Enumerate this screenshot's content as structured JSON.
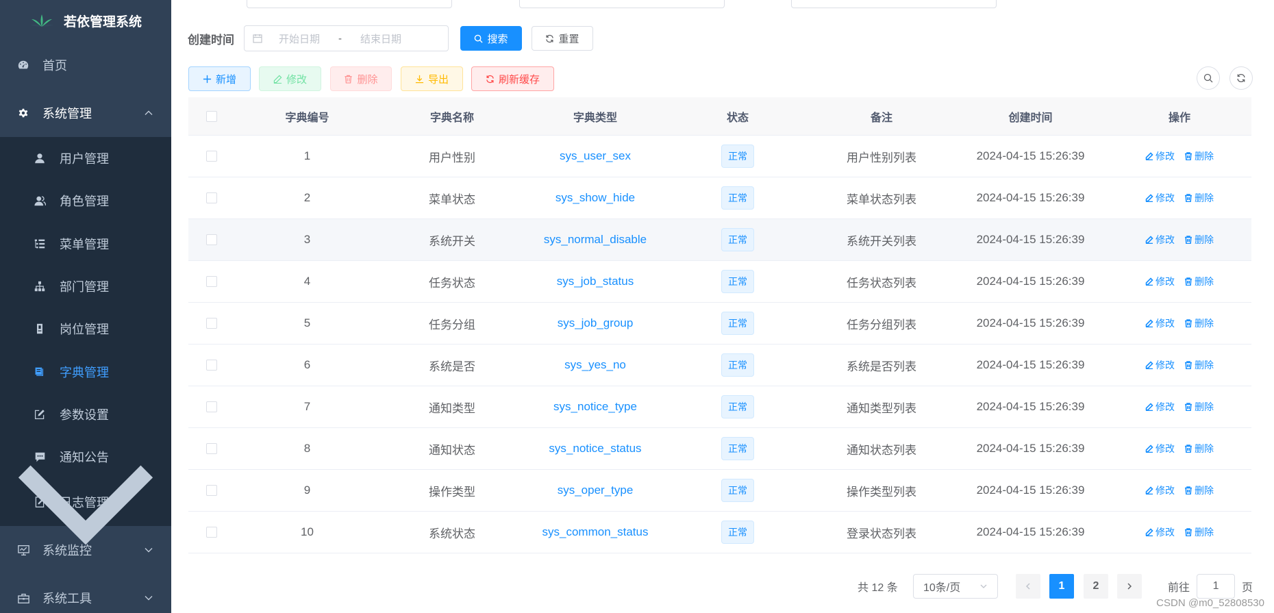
{
  "sidebar": {
    "logo_text": "若依管理系统",
    "items": [
      {
        "label": "首页",
        "icon": "dashboard-icon"
      },
      {
        "label": "系统管理",
        "icon": "gear-icon",
        "expanded": true
      },
      {
        "label": "系统监控",
        "icon": "monitor-icon"
      },
      {
        "label": "系统工具",
        "icon": "toolbox-icon"
      }
    ],
    "sub_items": [
      {
        "label": "用户管理",
        "icon": "user-icon"
      },
      {
        "label": "角色管理",
        "icon": "peoples-icon"
      },
      {
        "label": "菜单管理",
        "icon": "tree-table-icon"
      },
      {
        "label": "部门管理",
        "icon": "tree-icon"
      },
      {
        "label": "岗位管理",
        "icon": "post-icon"
      },
      {
        "label": "字典管理",
        "icon": "dict-icon",
        "active": true
      },
      {
        "label": "参数设置",
        "icon": "edit-icon"
      },
      {
        "label": "通知公告",
        "icon": "message-icon"
      },
      {
        "label": "日志管理",
        "icon": "log-icon"
      }
    ]
  },
  "search_form": {
    "created_label": "创建时间",
    "start_placeholder": "开始日期",
    "range_separator": "-",
    "end_placeholder": "结束日期",
    "search_label": "搜索",
    "reset_label": "重置"
  },
  "toolbar": {
    "add_label": "新增",
    "edit_label": "修改",
    "delete_label": "删除",
    "export_label": "导出",
    "refresh_cache_label": "刷新缓存"
  },
  "table": {
    "headers": [
      "字典编号",
      "字典名称",
      "字典类型",
      "状态",
      "备注",
      "创建时间",
      "操作"
    ],
    "rows": [
      {
        "id": "1",
        "name": "用户性别",
        "type": "sys_user_sex",
        "status": "正常",
        "remark": "用户性别列表",
        "created": "2024-04-15 15:26:39"
      },
      {
        "id": "2",
        "name": "菜单状态",
        "type": "sys_show_hide",
        "status": "正常",
        "remark": "菜单状态列表",
        "created": "2024-04-15 15:26:39"
      },
      {
        "id": "3",
        "name": "系统开关",
        "type": "sys_normal_disable",
        "status": "正常",
        "remark": "系统开关列表",
        "created": "2024-04-15 15:26:39"
      },
      {
        "id": "4",
        "name": "任务状态",
        "type": "sys_job_status",
        "status": "正常",
        "remark": "任务状态列表",
        "created": "2024-04-15 15:26:39"
      },
      {
        "id": "5",
        "name": "任务分组",
        "type": "sys_job_group",
        "status": "正常",
        "remark": "任务分组列表",
        "created": "2024-04-15 15:26:39"
      },
      {
        "id": "6",
        "name": "系统是否",
        "type": "sys_yes_no",
        "status": "正常",
        "remark": "系统是否列表",
        "created": "2024-04-15 15:26:39"
      },
      {
        "id": "7",
        "name": "通知类型",
        "type": "sys_notice_type",
        "status": "正常",
        "remark": "通知类型列表",
        "created": "2024-04-15 15:26:39"
      },
      {
        "id": "8",
        "name": "通知状态",
        "type": "sys_notice_status",
        "status": "正常",
        "remark": "通知状态列表",
        "created": "2024-04-15 15:26:39"
      },
      {
        "id": "9",
        "name": "操作类型",
        "type": "sys_oper_type",
        "status": "正常",
        "remark": "操作类型列表",
        "created": "2024-04-15 15:26:39"
      },
      {
        "id": "10",
        "name": "系统状态",
        "type": "sys_common_status",
        "status": "正常",
        "remark": "登录状态列表",
        "created": "2024-04-15 15:26:39"
      }
    ],
    "row_edit_label": "修改",
    "row_delete_label": "删除"
  },
  "pagination": {
    "total_text": "共 12 条",
    "page_size": "10条/页",
    "pages": [
      "1",
      "2"
    ],
    "current_page": "1",
    "goto_prefix": "前往",
    "goto_value": "1",
    "goto_suffix": "页"
  },
  "watermark": "CSDN @m0_52808530",
  "colors": {
    "sidebar_bg": "#304156",
    "submenu_bg": "#1f2d3d",
    "primary": "#1890ff",
    "active_menu": "#409eff"
  }
}
